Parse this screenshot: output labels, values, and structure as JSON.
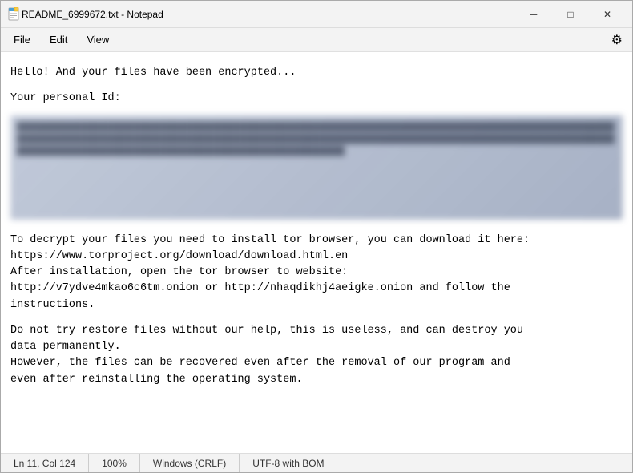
{
  "window": {
    "title": "README_6999672.txt - Notepad",
    "icon": "notepad-icon"
  },
  "titlebar": {
    "minimize_label": "─",
    "maximize_label": "□",
    "close_label": "✕"
  },
  "menubar": {
    "items": [
      {
        "label": "File"
      },
      {
        "label": "Edit"
      },
      {
        "label": "View"
      }
    ],
    "settings_icon": "⚙"
  },
  "editor": {
    "lines": [
      "",
      "Hello! And your files have been encrypted...",
      "",
      "Your personal Id:",
      "",
      "",
      "",
      "To decrypt your files you need to install tor browser, you can download it here:",
      "https://www.torproject.org/download/download.html.en",
      "After installation, open the tor browser to website:",
      "http://v7ydve4mkao6c6tm.onion or http://nhaqdikhj4aeigke.onion and follow the",
      "instructions.",
      "",
      "Do not try restore files without our help, this is useless, and can destroy you",
      "data permanently.",
      "However, the files can be recovered even after the removal of our program and",
      "even after reinstalling the operating system."
    ],
    "blurred_placeholder": "████████████████████████████████████████████████████████████████████████████████████████████████████████████████████████████████████████████████████████████████████████████████████████████████████████████████████████████████████████████████████████████████████████████████████████████████"
  },
  "statusbar": {
    "cursor": "Ln 11, Col 124",
    "zoom": "100%",
    "line_ending": "Windows (CRLF)",
    "encoding": "UTF-8 with BOM"
  }
}
